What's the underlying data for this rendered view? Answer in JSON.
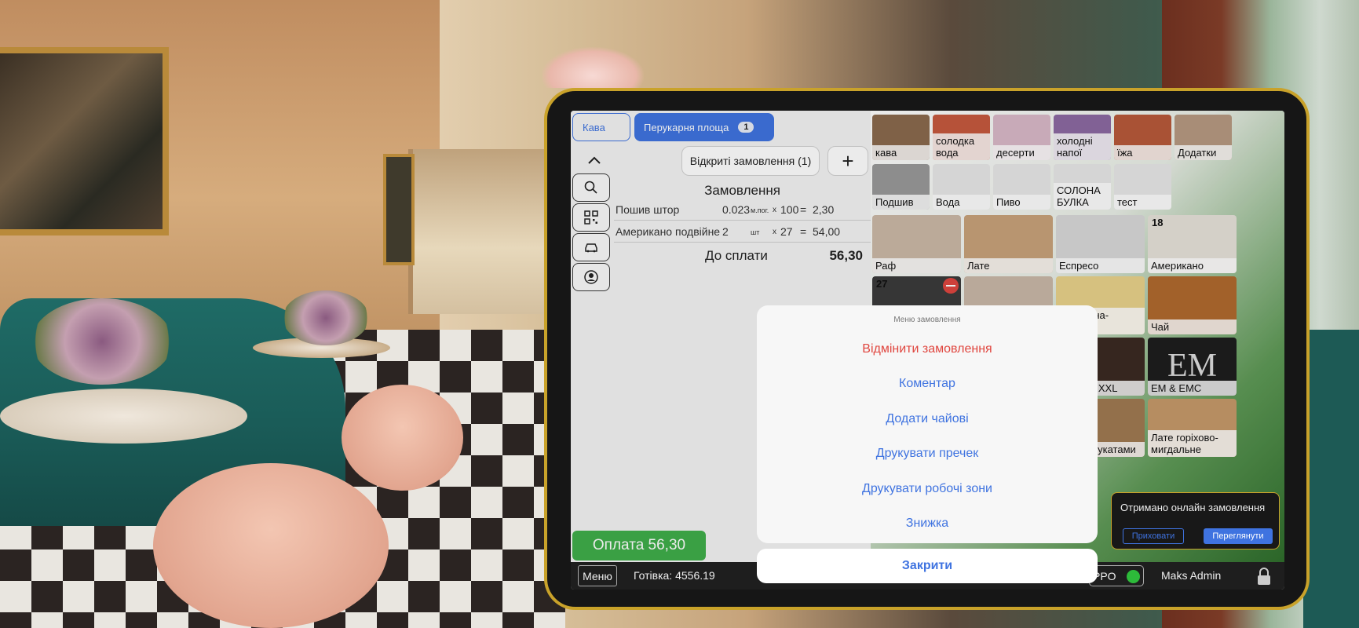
{
  "tabs": {
    "kava": "Кава",
    "bakery": "Перукарня площа",
    "bakery_badge": "1"
  },
  "toolbar": {
    "open_orders": "Відкриті замовлення (1)",
    "plus": "+"
  },
  "order": {
    "title": "Замовлення",
    "items": [
      {
        "name": "Пошив штор",
        "qty": "0.023",
        "unit": "м.пог.",
        "mult": "x",
        "price": "100",
        "eq": "=",
        "sum": "2,30"
      },
      {
        "name": "Американо подвійне",
        "qty": "2",
        "unit": "шт",
        "mult": "x",
        "price": "27",
        "eq": "=",
        "sum": "54,00"
      }
    ],
    "total_label": "До сплати",
    "total_value": "56,30"
  },
  "pay_button": "Оплата 56,30",
  "bottom_bar": {
    "menu": "Меню",
    "cash": "Готівка: 4556.19",
    "prro": "PPO",
    "user": "Maks Admin"
  },
  "categories": [
    {
      "label": "кава",
      "color": "#8a6a4e"
    },
    {
      "label": "солодка вода",
      "color": "#c65a3e"
    },
    {
      "label": "десерти",
      "color": "#d9b9c8"
    },
    {
      "label": "холодні напої",
      "color": "#8c6aa2"
    },
    {
      "label": "їжа",
      "color": "#b85a3a"
    },
    {
      "label": "Додатки",
      "color": "#b79a82"
    },
    {
      "label": "Подшив",
      "color": "#9a9a9a"
    },
    {
      "label": "Вода",
      "color": "#e8e8e8"
    },
    {
      "label": "Пиво",
      "color": "#e8e8e8"
    },
    {
      "label": "СОЛОНА БУЛКА",
      "color": "#e8e8e8"
    },
    {
      "label": "тест",
      "color": "#e8e8e8"
    }
  ],
  "products": [
    {
      "label": "Раф",
      "color": "#cbb9a6",
      "count": ""
    },
    {
      "label": "Лате",
      "color": "#c8a27a",
      "count": ""
    },
    {
      "label": "Еспресо",
      "color": "#d8d8d8",
      "count": ""
    },
    {
      "label": "Американо",
      "color": "#e6e2da",
      "count": "18"
    },
    {
      "label": "",
      "color": "#3b3b3b",
      "count": "27"
    },
    {
      "label": "",
      "color": "#c9b8a8",
      "count": ""
    },
    {
      "label": "Лате Піна-колада",
      "color": "#e9d28a",
      "count": ""
    },
    {
      "label": "Чай",
      "color": "#b06a2e",
      "count": ""
    },
    {
      "label": "",
      "color": "#5a4a3a",
      "count": ""
    },
    {
      "label": "",
      "color": "#c9b8a8",
      "count": ""
    },
    {
      "label": "Снікерс XXL",
      "color": "#3b2a22",
      "count": ""
    },
    {
      "label": "EM & EMC",
      "color": "#1e1e1e",
      "count": ""
    },
    {
      "label": "",
      "color": "#8a6a4e",
      "count": ""
    },
    {
      "label": "",
      "color": "#c9b8a8",
      "count": ""
    },
    {
      "label": "Лате з цукатами",
      "color": "#a07a52",
      "count": ""
    },
    {
      "label": "Лате горіхово-мигдальне",
      "color": "#c69a6a",
      "count": ""
    }
  ],
  "em_logo": "EM",
  "sheet": {
    "title": "Меню замовлення",
    "cancel": "Відмінити замовлення",
    "comment": "Коментар",
    "tips": "Додати чайові",
    "precheck": "Друкувати пречек",
    "work_zones": "Друкувати робочі зони",
    "discount": "Знижка",
    "close": "Закрити"
  },
  "toast": {
    "text": "Отримано онлайн замовлення",
    "hide": "Приховати",
    "view": "Переглянути"
  }
}
